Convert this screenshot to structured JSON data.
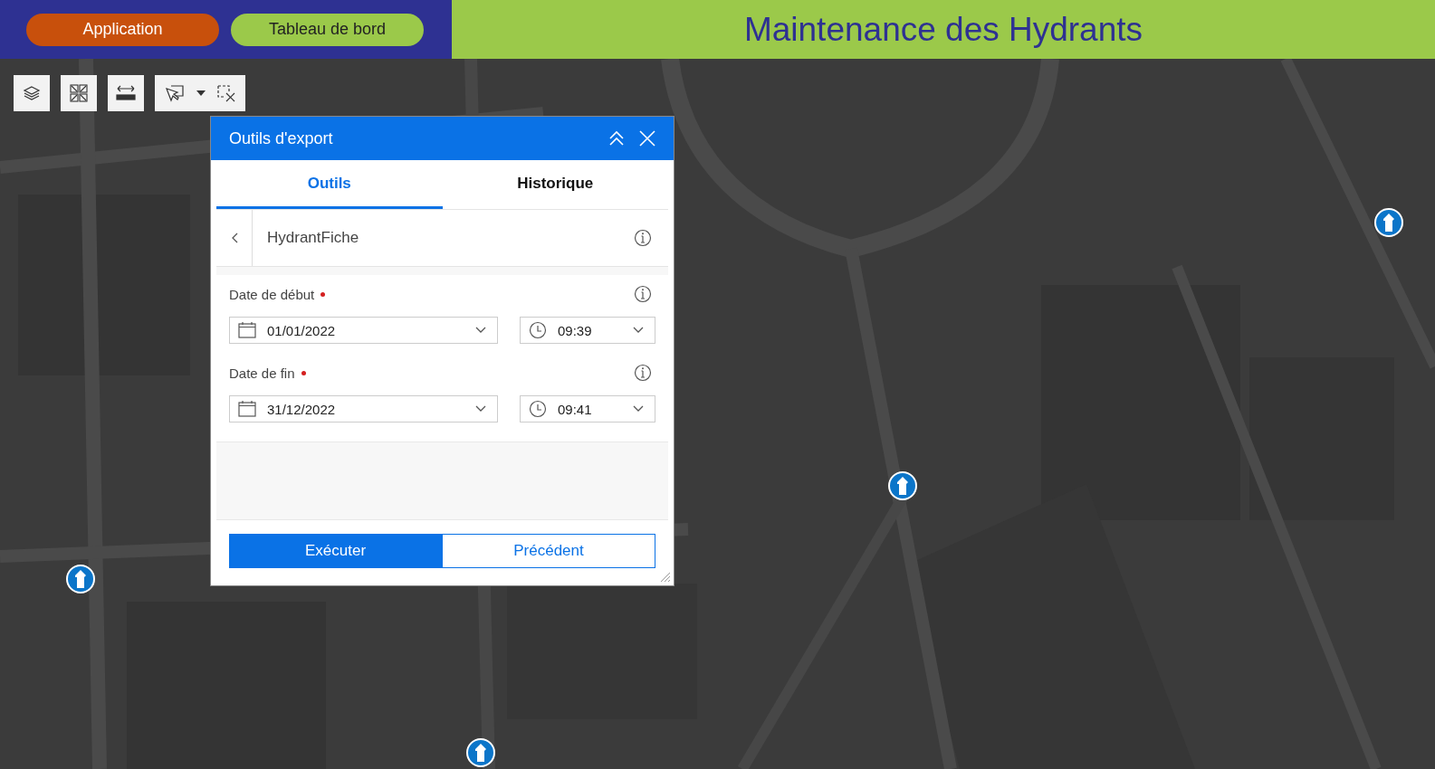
{
  "header": {
    "buttons": [
      {
        "label": "Application",
        "selected": true
      },
      {
        "label": "Tableau de bord",
        "selected": false
      }
    ],
    "title": "Maintenance des Hydrants"
  },
  "dialog": {
    "title": "Outils d'export",
    "tabs": [
      {
        "label": "Outils",
        "selected": true
      },
      {
        "label": "Historique",
        "selected": false
      }
    ],
    "tool": {
      "name": "HydrantFiche"
    },
    "fields": [
      {
        "label": "Date de début",
        "required": true,
        "date": "01/01/2022",
        "time": "09:39"
      },
      {
        "label": "Date de fin",
        "required": true,
        "date": "31/12/2022",
        "time": "09:41"
      }
    ],
    "buttons": [
      {
        "label": "Exécuter",
        "kind": "primary"
      },
      {
        "label": "Précédent",
        "kind": "secondary"
      }
    ]
  }
}
